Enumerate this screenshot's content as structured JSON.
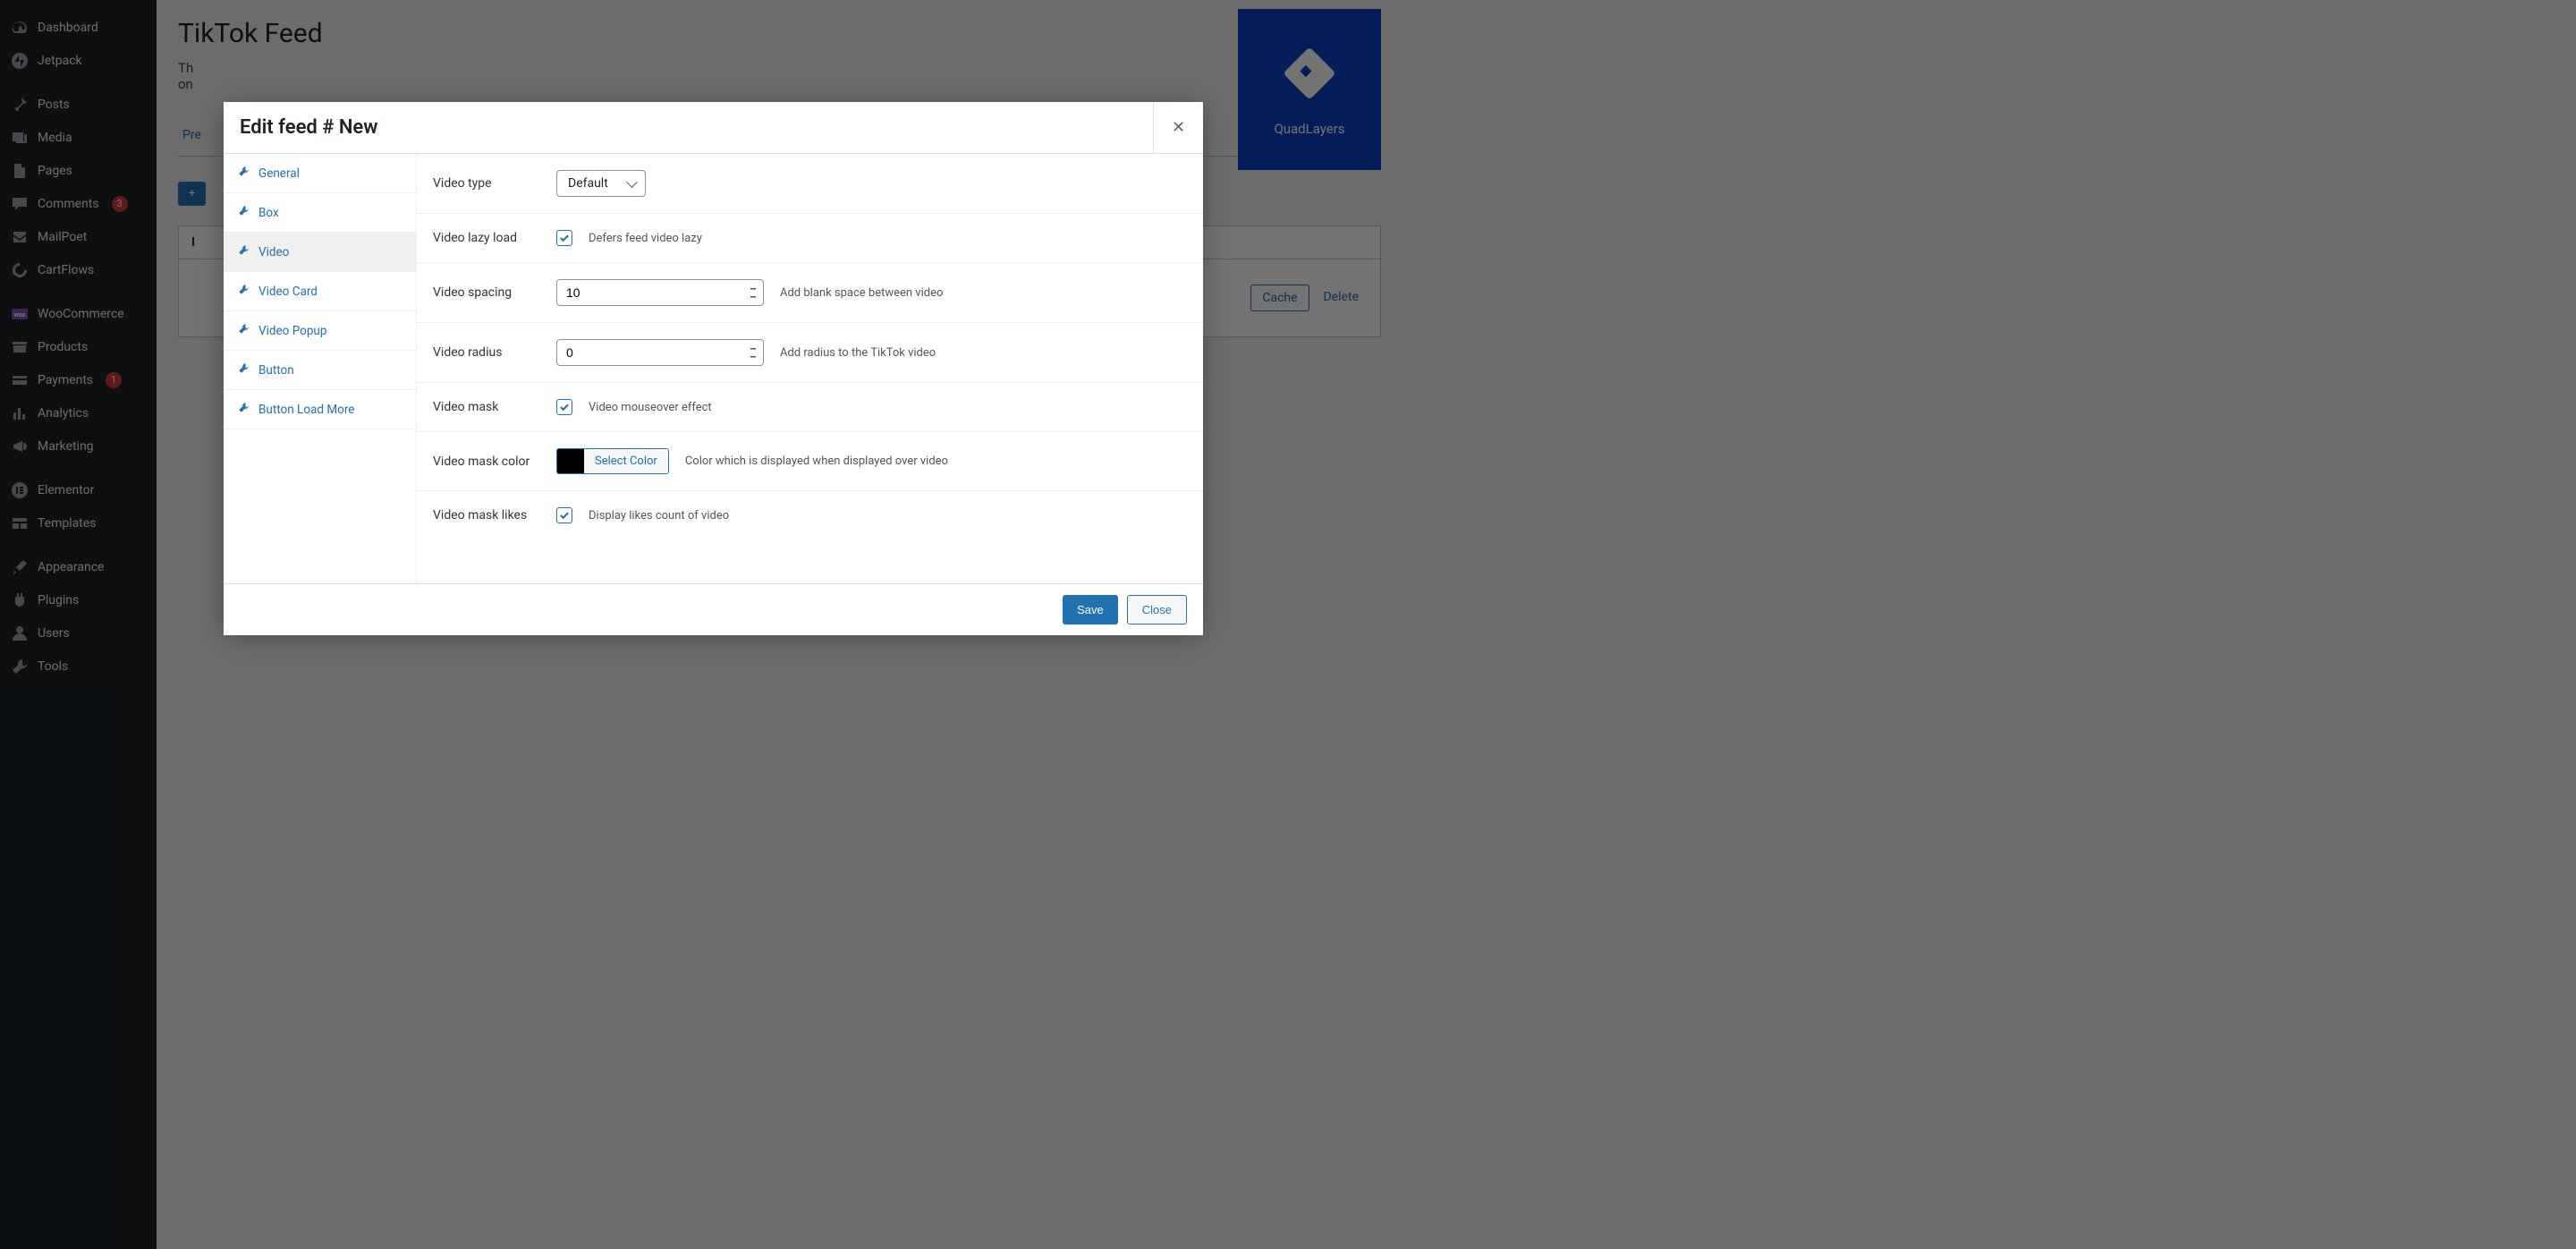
{
  "sidebar": {
    "items": [
      {
        "label": "Dashboard",
        "icon": "dashboard"
      },
      {
        "label": "Jetpack",
        "icon": "jetpack"
      },
      {
        "label": "Posts",
        "icon": "pin"
      },
      {
        "label": "Media",
        "icon": "media"
      },
      {
        "label": "Pages",
        "icon": "page"
      },
      {
        "label": "Comments",
        "icon": "comment",
        "badge": "3"
      },
      {
        "label": "MailPoet",
        "icon": "mailpoet"
      },
      {
        "label": "CartFlows",
        "icon": "cartflows"
      },
      {
        "label": "WooCommerce",
        "icon": "woo"
      },
      {
        "label": "Products",
        "icon": "archive"
      },
      {
        "label": "Payments",
        "icon": "payments",
        "badge": "1"
      },
      {
        "label": "Analytics",
        "icon": "analytics"
      },
      {
        "label": "Marketing",
        "icon": "megaphone"
      },
      {
        "label": "Elementor",
        "icon": "elementor"
      },
      {
        "label": "Templates",
        "icon": "templates"
      },
      {
        "label": "Appearance",
        "icon": "brush"
      },
      {
        "label": "Plugins",
        "icon": "plugin"
      },
      {
        "label": "Users",
        "icon": "user"
      },
      {
        "label": "Tools",
        "icon": "wrench"
      }
    ]
  },
  "page": {
    "title": "TikTok Feed",
    "intro_prefix": "Th",
    "intro_line2": "on",
    "tab": "Pre",
    "add_btn": "+ ",
    "table_header": "I",
    "cache_btn": "Cache",
    "delete_btn": "Delete"
  },
  "brand": {
    "label": "QuadLayers"
  },
  "modal": {
    "title": "Edit feed # New",
    "tabs": [
      "General",
      "Box",
      "Video",
      "Video Card",
      "Video Popup",
      "Button",
      "Button Load More"
    ],
    "active_tab_index": 2,
    "fields": {
      "video_type": {
        "label": "Video type",
        "value": "Default"
      },
      "video_lazy": {
        "label": "Video lazy load",
        "help": "Defers feed video lazy",
        "checked": true
      },
      "video_spacing": {
        "label": "Video spacing",
        "value": "10",
        "help": "Add blank space between video"
      },
      "video_radius": {
        "label": "Video radius",
        "value": "0",
        "help": "Add radius to the TikTok video"
      },
      "video_mask": {
        "label": "Video mask",
        "help": "Video mouseover effect",
        "checked": true
      },
      "video_mask_color": {
        "label": "Video mask color",
        "button": "Select Color",
        "help": "Color which is displayed when displayed over video",
        "color": "#000000"
      },
      "video_mask_likes": {
        "label": "Video mask likes",
        "help": "Display likes count of video",
        "checked": true
      }
    },
    "footer": {
      "save": "Save",
      "close": "Close"
    }
  }
}
